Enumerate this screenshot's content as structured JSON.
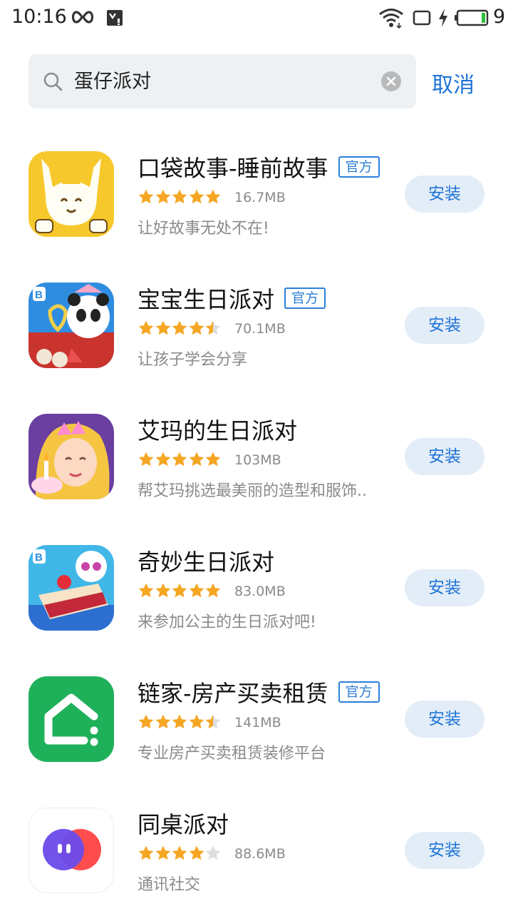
{
  "status_bar": {
    "time": "10:16",
    "battery_level": "9",
    "icons": [
      "infinity-icon",
      "notification-icon",
      "wifi-icon",
      "screen-icon",
      "charging-icon",
      "battery-icon"
    ]
  },
  "search": {
    "value": "蛋仔派对",
    "cancel_label": "取消"
  },
  "colors": {
    "accent": "#1f74d6",
    "install_bg": "#e3edf8",
    "star": "#f5a623"
  },
  "apps": [
    {
      "name": "口袋故事-睡前故事",
      "official": true,
      "badge": "官方",
      "rating": 5,
      "size": "16.7MB",
      "desc": "让好故事无处不在!",
      "install_label": "安装"
    },
    {
      "name": "宝宝生日派对",
      "official": true,
      "badge": "官方",
      "rating": 4.5,
      "size": "70.1MB",
      "desc": "让孩子学会分享",
      "install_label": "安装"
    },
    {
      "name": "艾玛的生日派对",
      "official": false,
      "badge": "",
      "rating": 5,
      "size": "103MB",
      "desc": "帮艾玛挑选最美丽的造型和服饰..",
      "install_label": "安装"
    },
    {
      "name": "奇妙生日派对",
      "official": false,
      "badge": "",
      "rating": 5,
      "size": "83.0MB",
      "desc": "来参加公主的生日派对吧!",
      "install_label": "安装"
    },
    {
      "name": "链家-房产买卖租赁",
      "official": true,
      "badge": "官方",
      "rating": 4.5,
      "size": "141MB",
      "desc": "专业房产买卖租赁装修平台",
      "install_label": "安装"
    },
    {
      "name": "同桌派对",
      "official": false,
      "badge": "",
      "rating": 4,
      "size": "88.6MB",
      "desc": "通讯社交",
      "install_label": "安装"
    }
  ]
}
